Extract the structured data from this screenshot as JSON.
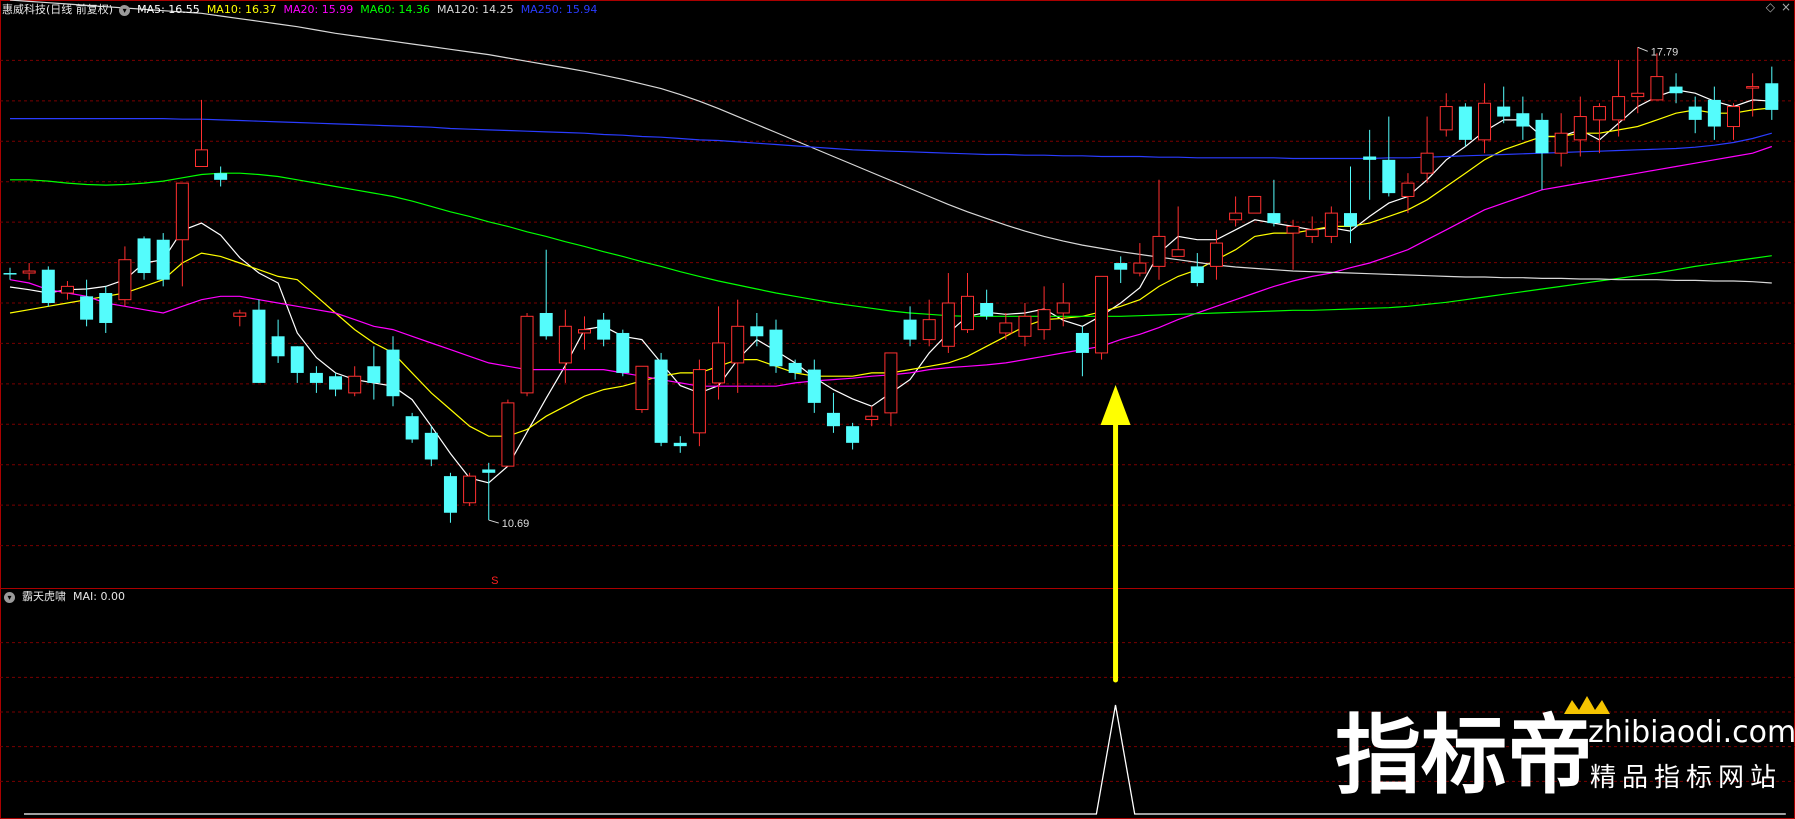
{
  "stock": {
    "title": "惠威科技(日线 前复权)",
    "ma_values": [
      {
        "label": "MA5: 16.55",
        "color": "#ffffff"
      },
      {
        "label": "MA10: 16.37",
        "color": "#ffff00"
      },
      {
        "label": "MA20: 15.99",
        "color": "#ff00ff"
      },
      {
        "label": "MA60: 14.36",
        "color": "#00ff00"
      },
      {
        "label": "MA120: 14.25",
        "color": "#d8d8d8"
      },
      {
        "label": "MA250: 15.94",
        "color": "#2a3cff"
      }
    ]
  },
  "indicator": {
    "title": "霸天虎啸",
    "value_label": "MAI: 0.00"
  },
  "watermark": {
    "brand": "指标帝",
    "domain": "zhibiaodi.com",
    "slogan": "精品指标网站"
  },
  "chart_data": {
    "type": "candlestick",
    "title": "惠威科技(日线 前复权)",
    "ylim": [
      9.7,
      18.2
    ],
    "grid": true,
    "annotations": [
      {
        "text": "17.79",
        "type": "high-marker",
        "index": 85,
        "price": 17.79
      },
      {
        "text": "10.69",
        "type": "low-marker",
        "index": 25,
        "price": 10.69
      },
      {
        "text": "S",
        "type": "signal-marker",
        "index": 25,
        "color": "#ff2020"
      },
      {
        "type": "arrow",
        "index": 57,
        "color": "#ffff00",
        "direction": "up"
      }
    ],
    "candles": [
      [
        14.4,
        14.38,
        14.48,
        14.3
      ],
      [
        14.4,
        14.43,
        14.55,
        14.3
      ],
      [
        14.45,
        13.95,
        14.5,
        13.9
      ],
      [
        14.1,
        14.2,
        14.28,
        14.0
      ],
      [
        14.05,
        13.7,
        14.3,
        13.6
      ],
      [
        14.1,
        13.65,
        14.2,
        13.5
      ],
      [
        14.0,
        14.6,
        14.8,
        13.9
      ],
      [
        14.92,
        14.4,
        14.95,
        14.3
      ],
      [
        14.9,
        14.3,
        15.0,
        14.2
      ],
      [
        14.9,
        15.75,
        15.75,
        14.2
      ],
      [
        16.0,
        16.25,
        17.0,
        16.0
      ],
      [
        15.9,
        15.8,
        16.0,
        15.7
      ],
      [
        13.75,
        13.8,
        13.85,
        13.6
      ],
      [
        13.85,
        12.75,
        14.0,
        12.75
      ],
      [
        13.45,
        13.15,
        13.7,
        13.05
      ],
      [
        13.3,
        12.9,
        13.3,
        12.75
      ],
      [
        12.9,
        12.75,
        13.0,
        12.6
      ],
      [
        12.85,
        12.65,
        12.9,
        12.55
      ],
      [
        12.6,
        12.85,
        13.0,
        12.55
      ],
      [
        13.0,
        12.75,
        13.3,
        12.5
      ],
      [
        13.25,
        12.55,
        13.45,
        12.4
      ],
      [
        12.25,
        11.9,
        12.3,
        11.85
      ],
      [
        12.0,
        11.6,
        12.1,
        11.5
      ],
      [
        11.35,
        10.8,
        11.4,
        10.65
      ],
      [
        10.95,
        11.35,
        11.4,
        10.9
      ],
      [
        11.45,
        11.4,
        11.55,
        10.69
      ],
      [
        11.5,
        12.45,
        12.5,
        11.5
      ],
      [
        12.6,
        13.75,
        13.8,
        12.55
      ],
      [
        13.8,
        13.45,
        14.75,
        13.4
      ],
      [
        13.05,
        13.6,
        13.85,
        12.75
      ],
      [
        13.5,
        13.55,
        13.75,
        13.25
      ],
      [
        13.7,
        13.4,
        13.8,
        13.3
      ],
      [
        13.5,
        12.9,
        13.55,
        12.85
      ],
      [
        12.35,
        13.0,
        13.0,
        12.3
      ],
      [
        13.1,
        11.85,
        13.2,
        11.8
      ],
      [
        11.85,
        11.8,
        11.95,
        11.7
      ],
      [
        12.0,
        12.95,
        13.1,
        11.8
      ],
      [
        12.75,
        13.35,
        13.9,
        12.5
      ],
      [
        13.05,
        13.6,
        14.0,
        12.6
      ],
      [
        13.6,
        13.45,
        13.8,
        13.3
      ],
      [
        13.55,
        13.0,
        13.7,
        12.9
      ],
      [
        13.05,
        12.9,
        13.1,
        12.8
      ],
      [
        12.95,
        12.45,
        13.1,
        12.3
      ],
      [
        12.3,
        12.1,
        12.6,
        12.0
      ],
      [
        12.1,
        11.85,
        12.15,
        11.75
      ],
      [
        12.2,
        12.25,
        12.4,
        12.1
      ],
      [
        12.3,
        13.2,
        13.2,
        12.1
      ],
      [
        13.7,
        13.4,
        13.9,
        13.3
      ],
      [
        13.4,
        13.7,
        14.0,
        13.3
      ],
      [
        13.3,
        13.95,
        14.4,
        13.2
      ],
      [
        13.55,
        14.05,
        14.4,
        13.5
      ],
      [
        13.95,
        13.75,
        14.15,
        13.7
      ],
      [
        13.5,
        13.65,
        13.8,
        13.4
      ],
      [
        13.45,
        13.75,
        13.95,
        13.3
      ],
      [
        13.55,
        13.85,
        14.2,
        13.4
      ],
      [
        13.8,
        13.95,
        14.25,
        13.6
      ],
      [
        13.5,
        13.2,
        13.6,
        12.85
      ],
      [
        13.2,
        14.35,
        14.35,
        13.1
      ],
      [
        14.55,
        14.45,
        14.65,
        14.25
      ],
      [
        14.4,
        14.55,
        14.85,
        14.35
      ],
      [
        14.5,
        14.95,
        15.8,
        14.3
      ],
      [
        14.65,
        14.75,
        15.4,
        14.65
      ],
      [
        14.5,
        14.25,
        14.7,
        14.2
      ],
      [
        14.5,
        14.85,
        15.05,
        14.3
      ],
      [
        15.2,
        15.3,
        15.55,
        15.1
      ],
      [
        15.3,
        15.55,
        15.55,
        15.3
      ],
      [
        15.3,
        15.15,
        15.8,
        15.1
      ],
      [
        15.0,
        15.1,
        15.2,
        14.45
      ],
      [
        14.95,
        15.05,
        15.25,
        14.85
      ],
      [
        14.95,
        15.3,
        15.4,
        14.85
      ],
      [
        15.3,
        15.1,
        16.0,
        14.85
      ],
      [
        16.15,
        16.1,
        16.55,
        15.5
      ],
      [
        16.1,
        15.6,
        16.75,
        15.55
      ],
      [
        15.55,
        15.75,
        15.9,
        15.3
      ],
      [
        15.9,
        16.2,
        16.75,
        15.75
      ],
      [
        16.55,
        16.9,
        17.1,
        16.45
      ],
      [
        16.9,
        16.4,
        16.95,
        16.3
      ],
      [
        16.4,
        16.95,
        17.25,
        16.2
      ],
      [
        16.9,
        16.75,
        17.2,
        16.65
      ],
      [
        16.8,
        16.6,
        17.05,
        16.4
      ],
      [
        16.7,
        16.2,
        16.8,
        15.65
      ],
      [
        16.2,
        16.5,
        16.8,
        16.0
      ],
      [
        16.4,
        16.75,
        17.05,
        16.15
      ],
      [
        16.7,
        16.9,
        16.95,
        16.2
      ],
      [
        16.7,
        17.05,
        17.6,
        16.45
      ],
      [
        17.05,
        17.1,
        17.79,
        16.8
      ],
      [
        17.0,
        17.35,
        17.7,
        17.0
      ],
      [
        17.2,
        17.1,
        17.4,
        16.95
      ],
      [
        16.9,
        16.7,
        17.05,
        16.5
      ],
      [
        17.0,
        16.6,
        17.2,
        16.4
      ],
      [
        16.6,
        16.9,
        16.95,
        16.4
      ],
      [
        17.2,
        17.2,
        17.4,
        16.75
      ],
      [
        17.25,
        16.85,
        17.5,
        16.7
      ]
    ],
    "series": [
      {
        "name": "MA5",
        "color": "#ffffff",
        "values": [
          14.19,
          14.15,
          14.1,
          14.15,
          14.16,
          14.2,
          14.3,
          14.55,
          14.6,
          15.04,
          15.15,
          14.97,
          14.63,
          14.4,
          14.25,
          13.5,
          13.13,
          12.9,
          12.8,
          12.75,
          12.7,
          12.5,
          12.1,
          11.69,
          11.32,
          11.25,
          11.5,
          12.01,
          12.52,
          13.01,
          13.55,
          13.6,
          13.45,
          13.4,
          13.05,
          12.71,
          12.6,
          12.71,
          13.1,
          13.4,
          13.23,
          13.05,
          12.83,
          12.65,
          12.51,
          12.4,
          12.6,
          12.8,
          13.2,
          13.5,
          13.75,
          13.81,
          13.78,
          13.8,
          13.86,
          13.69,
          13.6,
          13.76,
          13.95,
          14.18,
          14.7,
          14.95,
          14.9,
          14.9,
          15.05,
          15.2,
          15.15,
          15.1,
          15.05,
          15.08,
          15.03,
          15.25,
          15.45,
          15.55,
          15.8,
          16.1,
          16.3,
          16.53,
          16.7,
          16.7,
          16.45,
          16.45,
          16.55,
          16.4,
          16.65,
          16.9,
          17.05,
          17.15,
          17.1,
          16.98,
          16.9,
          17.0,
          16.98
        ]
      },
      {
        "name": "MA10",
        "color": "#ffff00",
        "values": [
          13.8,
          13.85,
          13.9,
          13.95,
          14.0,
          14.05,
          14.1,
          14.2,
          14.3,
          14.55,
          14.7,
          14.65,
          14.55,
          14.45,
          14.35,
          14.3,
          14.05,
          13.8,
          13.55,
          13.35,
          13.2,
          12.9,
          12.6,
          12.35,
          12.1,
          11.95,
          11.95,
          12.05,
          12.25,
          12.4,
          12.55,
          12.65,
          12.7,
          12.78,
          12.85,
          12.9,
          12.9,
          13.0,
          13.1,
          13.1,
          13.0,
          12.9,
          12.85,
          12.85,
          12.85,
          12.9,
          12.9,
          12.95,
          13.0,
          13.05,
          13.15,
          13.3,
          13.45,
          13.6,
          13.7,
          13.72,
          13.75,
          13.82,
          13.9,
          14.0,
          14.2,
          14.35,
          14.45,
          14.6,
          14.75,
          14.95,
          15.0,
          15.0,
          15.05,
          15.1,
          15.1,
          15.15,
          15.25,
          15.35,
          15.5,
          15.7,
          15.9,
          16.1,
          16.25,
          16.35,
          16.45,
          16.45,
          16.5,
          16.5,
          16.55,
          16.6,
          16.7,
          16.8,
          16.85,
          16.8,
          16.8,
          16.85,
          16.88
        ]
      },
      {
        "name": "MA20",
        "color": "#ff00ff",
        "values": [
          14.3,
          14.25,
          14.15,
          14.1,
          14.05,
          13.95,
          13.9,
          13.85,
          13.8,
          13.9,
          14.0,
          14.05,
          14.05,
          14.0,
          13.95,
          13.9,
          13.85,
          13.8,
          13.7,
          13.6,
          13.55,
          13.45,
          13.35,
          13.25,
          13.15,
          13.05,
          13.0,
          12.95,
          12.95,
          12.95,
          12.95,
          12.95,
          12.9,
          12.85,
          12.8,
          12.75,
          12.7,
          12.7,
          12.7,
          12.7,
          12.7,
          12.75,
          12.78,
          12.8,
          12.82,
          12.85,
          12.87,
          12.9,
          12.95,
          12.98,
          13.0,
          13.02,
          13.05,
          13.1,
          13.15,
          13.2,
          13.25,
          13.3,
          13.4,
          13.48,
          13.58,
          13.7,
          13.8,
          13.9,
          14.0,
          14.1,
          14.2,
          14.28,
          14.35,
          14.4,
          14.48,
          14.55,
          14.65,
          14.75,
          14.9,
          15.05,
          15.2,
          15.35,
          15.45,
          15.55,
          15.65,
          15.7,
          15.75,
          15.8,
          15.85,
          15.9,
          15.95,
          16.0,
          16.05,
          16.1,
          16.15,
          16.2,
          16.3
        ]
      },
      {
        "name": "MA60",
        "color": "#00ff00",
        "values": [
          15.8,
          15.8,
          15.78,
          15.75,
          15.73,
          15.72,
          15.73,
          15.75,
          15.78,
          15.83,
          15.88,
          15.9,
          15.9,
          15.88,
          15.85,
          15.8,
          15.75,
          15.7,
          15.65,
          15.6,
          15.55,
          15.48,
          15.4,
          15.32,
          15.25,
          15.17,
          15.1,
          15.02,
          14.95,
          14.87,
          14.8,
          14.72,
          14.65,
          14.57,
          14.5,
          14.42,
          14.35,
          14.28,
          14.22,
          14.16,
          14.1,
          14.05,
          14.0,
          13.95,
          13.91,
          13.87,
          13.83,
          13.8,
          13.78,
          13.76,
          13.75,
          13.75,
          13.75,
          13.75,
          13.75,
          13.75,
          13.75,
          13.75,
          13.75,
          13.76,
          13.77,
          13.78,
          13.79,
          13.8,
          13.81,
          13.82,
          13.83,
          13.84,
          13.84,
          13.85,
          13.86,
          13.87,
          13.88,
          13.9,
          13.93,
          13.96,
          14.0,
          14.04,
          14.08,
          14.12,
          14.16,
          14.2,
          14.24,
          14.28,
          14.32,
          14.36,
          14.4,
          14.45,
          14.5,
          14.54,
          14.58,
          14.62,
          14.66
        ]
      },
      {
        "name": "MA120",
        "color": "#d8d8d8",
        "values": [
          18.5,
          18.48,
          18.46,
          18.44,
          18.42,
          18.4,
          18.38,
          18.36,
          18.34,
          18.32,
          18.3,
          18.26,
          18.22,
          18.18,
          18.14,
          18.1,
          18.05,
          18.0,
          17.96,
          17.92,
          17.88,
          17.84,
          17.8,
          17.76,
          17.72,
          17.68,
          17.63,
          17.58,
          17.53,
          17.48,
          17.43,
          17.37,
          17.31,
          17.24,
          17.17,
          17.08,
          16.98,
          16.87,
          16.75,
          16.63,
          16.51,
          16.39,
          16.27,
          16.15,
          16.03,
          15.91,
          15.79,
          15.67,
          15.55,
          15.43,
          15.32,
          15.22,
          15.12,
          15.03,
          14.95,
          14.88,
          14.82,
          14.77,
          14.72,
          14.68,
          14.64,
          14.6,
          14.56,
          14.52,
          14.49,
          14.47,
          14.45,
          14.43,
          14.42,
          14.41,
          14.4,
          14.39,
          14.38,
          14.37,
          14.36,
          14.35,
          14.34,
          14.34,
          14.33,
          14.33,
          14.32,
          14.32,
          14.31,
          14.31,
          14.3,
          14.3,
          14.3,
          14.29,
          14.29,
          14.28,
          14.28,
          14.27,
          14.25
        ]
      },
      {
        "name": "MA250",
        "color": "#2a3cff",
        "values": [
          16.72,
          16.72,
          16.72,
          16.72,
          16.72,
          16.72,
          16.72,
          16.72,
          16.72,
          16.71,
          16.71,
          16.7,
          16.69,
          16.68,
          16.67,
          16.66,
          16.65,
          16.64,
          16.63,
          16.62,
          16.61,
          16.6,
          16.59,
          16.57,
          16.56,
          16.55,
          16.54,
          16.53,
          16.52,
          16.51,
          16.5,
          16.48,
          16.47,
          16.45,
          16.44,
          16.42,
          16.4,
          16.39,
          16.37,
          16.35,
          16.33,
          16.31,
          16.29,
          16.27,
          16.25,
          16.24,
          16.23,
          16.22,
          16.21,
          16.2,
          16.19,
          16.18,
          16.18,
          16.17,
          16.17,
          16.16,
          16.16,
          16.15,
          16.15,
          16.15,
          16.14,
          16.14,
          16.13,
          16.13,
          16.13,
          16.13,
          16.13,
          16.12,
          16.12,
          16.12,
          16.12,
          16.12,
          16.13,
          16.13,
          16.14,
          16.15,
          16.16,
          16.17,
          16.18,
          16.19,
          16.2,
          16.21,
          16.22,
          16.23,
          16.24,
          16.25,
          16.26,
          16.27,
          16.29,
          16.32,
          16.36,
          16.42,
          16.5
        ]
      }
    ],
    "sub_chart": {
      "name": "霸天虎啸",
      "series": "MAI",
      "ylim": [
        0,
        1
      ],
      "values": [
        0,
        0,
        0,
        0,
        0,
        0,
        0,
        0,
        0,
        0,
        0,
        0,
        0,
        0,
        0,
        0,
        0,
        0,
        0,
        0,
        0,
        0,
        0,
        0,
        0,
        0,
        0,
        0,
        0,
        0,
        0,
        0,
        0,
        0,
        0,
        0,
        0,
        0,
        0,
        0,
        0,
        0,
        0,
        0,
        0,
        0,
        0,
        0,
        0,
        0,
        0,
        0,
        0,
        0,
        0,
        0,
        0,
        1,
        0,
        0,
        0,
        0,
        0,
        0,
        0,
        0,
        0,
        0,
        0,
        0,
        0,
        0,
        0,
        0,
        0,
        0,
        0,
        0,
        0,
        0,
        0,
        0,
        0,
        0,
        0,
        0,
        0,
        0,
        0,
        0,
        0,
        0,
        0
      ]
    },
    "colors": {
      "up": "#ff3030",
      "down": "#54fcfc",
      "grid": "#7a0000",
      "border": "#aa0000"
    }
  }
}
